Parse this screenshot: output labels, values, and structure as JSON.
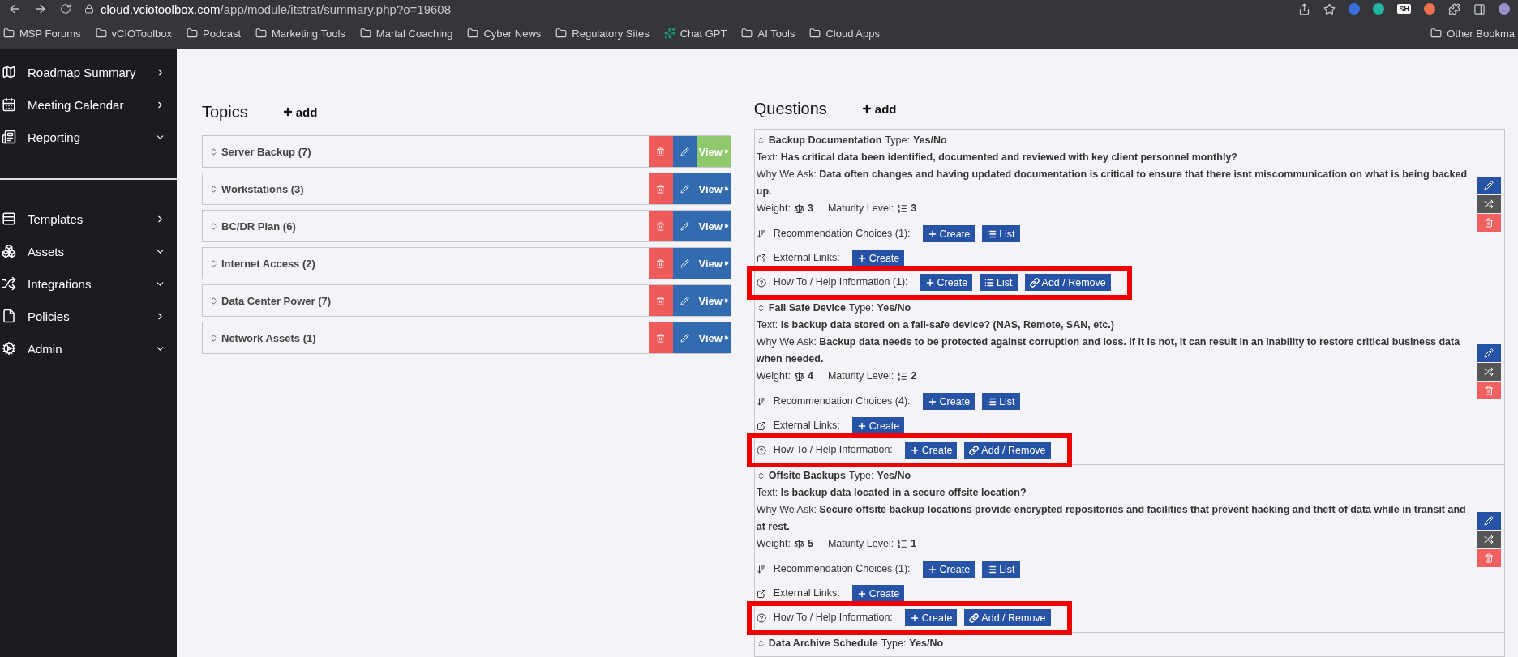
{
  "browser": {
    "url_host": "cloud.vciotoolbox.com",
    "url_path": "/app/module/itstrat/summary.php?o=19608",
    "extension_badge": "SH",
    "bookmarks": [
      {
        "label": "MSP Forums",
        "kind": "folder"
      },
      {
        "label": "vCIOToolbox",
        "kind": "folder"
      },
      {
        "label": "Podcast",
        "kind": "folder"
      },
      {
        "label": "Marketing Tools",
        "kind": "folder"
      },
      {
        "label": "Martal Coaching",
        "kind": "folder"
      },
      {
        "label": "Cyber News",
        "kind": "folder"
      },
      {
        "label": "Regulatory Sites",
        "kind": "folder"
      },
      {
        "label": "Chat GPT",
        "kind": "site"
      },
      {
        "label": "AI Tools",
        "kind": "folder"
      },
      {
        "label": "Cloud Apps",
        "kind": "folder"
      }
    ],
    "other_bookmarks": "Other Bookma"
  },
  "sidebar": {
    "sections": [
      [
        {
          "label": "Roadmap Summary",
          "expanded": false
        },
        {
          "label": "Meeting Calendar",
          "expanded": false
        },
        {
          "label": "Reporting",
          "expanded": true
        }
      ],
      [
        {
          "label": "Templates",
          "expanded": false
        },
        {
          "label": "Assets",
          "expanded": true
        },
        {
          "label": "Integrations",
          "expanded": true
        },
        {
          "label": "Policies",
          "expanded": false
        },
        {
          "label": "Admin",
          "expanded": true
        }
      ]
    ]
  },
  "topics": {
    "title": "Topics",
    "add": "add",
    "items": [
      {
        "label": "Server Backup (7)",
        "view": "View",
        "selected": true
      },
      {
        "label": "Workstations (3)",
        "view": "View",
        "selected": false
      },
      {
        "label": "BC/DR Plan (6)",
        "view": "View",
        "selected": false
      },
      {
        "label": "Internet Access (2)",
        "view": "View",
        "selected": false
      },
      {
        "label": "Data Center Power (7)",
        "view": "View",
        "selected": false
      },
      {
        "label": "Network Assets (1)",
        "view": "View",
        "selected": false
      }
    ]
  },
  "questions": {
    "title": "Questions",
    "add": "add",
    "items": [
      {
        "title": "Backup Documentation",
        "type_label": "Type:",
        "type": "Yes/No",
        "text_label": "Text:",
        "text": "Has critical data been identified, documented and reviewed with key client personnel monthly?",
        "why_label": "Why We Ask:",
        "why": "Data often changes and having updated documentation is critical to ensure that there isnt miscommunication on what is being backed up.",
        "weight_label": "Weight:",
        "weight": "3",
        "maturity_label": "Maturity Level:",
        "maturity": "3",
        "rows": [
          {
            "kind": "recommendations",
            "label": "Recommendation Choices (1):",
            "highlighted": false,
            "buttons": [
              {
                "kind": "create",
                "label": "Create"
              },
              {
                "kind": "list",
                "label": "List"
              }
            ]
          },
          {
            "kind": "links",
            "label": "External Links:",
            "highlighted": false,
            "buttons": [
              {
                "kind": "create",
                "label": "Create"
              }
            ]
          },
          {
            "kind": "help",
            "label": "How To / Help Information (1):",
            "highlighted": true,
            "buttons": [
              {
                "kind": "create",
                "label": "Create"
              },
              {
                "kind": "list",
                "label": "List"
              },
              {
                "kind": "link",
                "label": "Add / Remove"
              }
            ]
          }
        ]
      },
      {
        "title": "Fail Safe Device",
        "type_label": "Type:",
        "type": "Yes/No",
        "text_label": "Text:",
        "text": "Is backup data stored on a fail-safe device? (NAS, Remote, SAN, etc.)",
        "why_label": "Why We Ask:",
        "why": "Backup data needs to be protected against corruption and loss. If it is not, it can result in an inability to restore critical business data when needed.",
        "weight_label": "Weight:",
        "weight": "4",
        "maturity_label": "Maturity Level:",
        "maturity": "2",
        "rows": [
          {
            "kind": "recommendations",
            "label": "Recommendation Choices (4):",
            "highlighted": false,
            "buttons": [
              {
                "kind": "create",
                "label": "Create"
              },
              {
                "kind": "list",
                "label": "List"
              }
            ]
          },
          {
            "kind": "links",
            "label": "External Links:",
            "highlighted": false,
            "buttons": [
              {
                "kind": "create",
                "label": "Create"
              }
            ]
          },
          {
            "kind": "help",
            "label": "How To / Help Information:",
            "highlighted": true,
            "buttons": [
              {
                "kind": "create",
                "label": "Create"
              },
              {
                "kind": "link",
                "label": "Add / Remove"
              }
            ]
          }
        ]
      },
      {
        "title": "Offsite Backups",
        "type_label": "Type:",
        "type": "Yes/No",
        "text_label": "Text:",
        "text": "Is backup data located in a secure offsite location?",
        "why_label": "Why We Ask:",
        "why": "Secure offsite backup locations provide encrypted repositories and facilities that prevent hacking and theft of data while in transit and at rest.",
        "weight_label": "Weight:",
        "weight": "5",
        "maturity_label": "Maturity Level:",
        "maturity": "1",
        "rows": [
          {
            "kind": "recommendations",
            "label": "Recommendation Choices (1):",
            "highlighted": false,
            "buttons": [
              {
                "kind": "create",
                "label": "Create"
              },
              {
                "kind": "list",
                "label": "List"
              }
            ]
          },
          {
            "kind": "links",
            "label": "External Links:",
            "highlighted": false,
            "buttons": [
              {
                "kind": "create",
                "label": "Create"
              }
            ]
          },
          {
            "kind": "help",
            "label": "How To / Help Information:",
            "highlighted": true,
            "buttons": [
              {
                "kind": "create",
                "label": "Create"
              },
              {
                "kind": "link",
                "label": "Add / Remove"
              }
            ]
          }
        ]
      },
      {
        "title": "Data Archive Schedule",
        "type_label": "Type:",
        "type": "Yes/No"
      }
    ]
  }
}
